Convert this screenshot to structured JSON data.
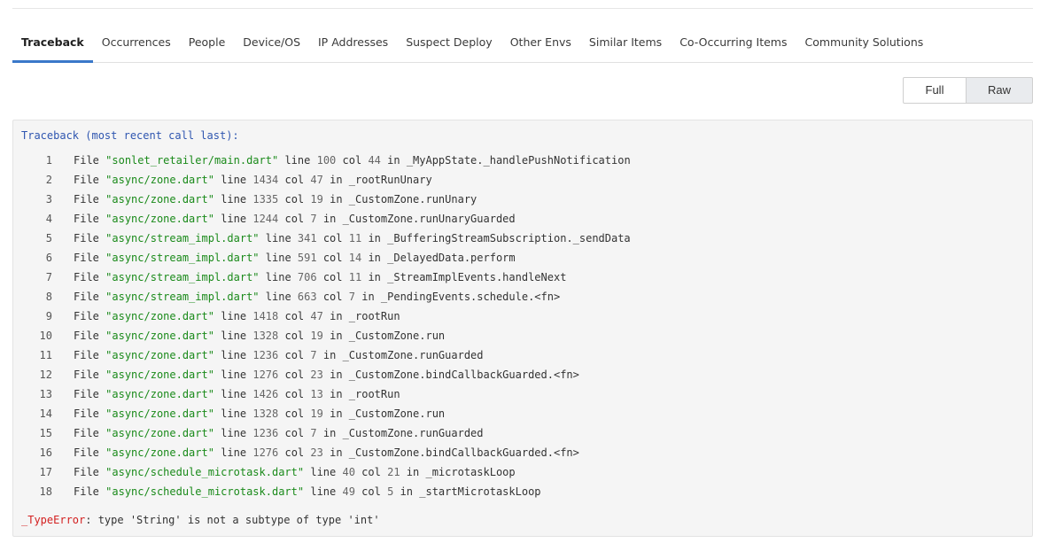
{
  "tabs": [
    {
      "label": "Traceback",
      "active": true
    },
    {
      "label": "Occurrences",
      "active": false
    },
    {
      "label": "People",
      "active": false
    },
    {
      "label": "Device/OS",
      "active": false
    },
    {
      "label": "IP Addresses",
      "active": false
    },
    {
      "label": "Suspect Deploy",
      "active": false
    },
    {
      "label": "Other Envs",
      "active": false
    },
    {
      "label": "Similar Items",
      "active": false
    },
    {
      "label": "Co-Occurring Items",
      "active": false
    },
    {
      "label": "Community Solutions",
      "active": false
    }
  ],
  "view_toggle": {
    "full_label": "Full",
    "raw_label": "Raw",
    "selected": "Raw"
  },
  "traceback": {
    "header": "Traceback (most recent call last):",
    "words": {
      "file": "File",
      "line": "line",
      "col": "col",
      "in": "in"
    },
    "frames": [
      {
        "n": "1",
        "file": "\"sonlet_retailer/main.dart\"",
        "line": "100",
        "col": "44",
        "func": "_MyAppState._handlePushNotification"
      },
      {
        "n": "2",
        "file": "\"async/zone.dart\"",
        "line": "1434",
        "col": "47",
        "func": "_rootRunUnary"
      },
      {
        "n": "3",
        "file": "\"async/zone.dart\"",
        "line": "1335",
        "col": "19",
        "func": "_CustomZone.runUnary"
      },
      {
        "n": "4",
        "file": "\"async/zone.dart\"",
        "line": "1244",
        "col": "7",
        "func": "_CustomZone.runUnaryGuarded"
      },
      {
        "n": "5",
        "file": "\"async/stream_impl.dart\"",
        "line": "341",
        "col": "11",
        "func": "_BufferingStreamSubscription._sendData"
      },
      {
        "n": "6",
        "file": "\"async/stream_impl.dart\"",
        "line": "591",
        "col": "14",
        "func": "_DelayedData.perform"
      },
      {
        "n": "7",
        "file": "\"async/stream_impl.dart\"",
        "line": "706",
        "col": "11",
        "func": "_StreamImplEvents.handleNext"
      },
      {
        "n": "8",
        "file": "\"async/stream_impl.dart\"",
        "line": "663",
        "col": "7",
        "func": "_PendingEvents.schedule.<fn>"
      },
      {
        "n": "9",
        "file": "\"async/zone.dart\"",
        "line": "1418",
        "col": "47",
        "func": "_rootRun"
      },
      {
        "n": "10",
        "file": "\"async/zone.dart\"",
        "line": "1328",
        "col": "19",
        "func": "_CustomZone.run"
      },
      {
        "n": "11",
        "file": "\"async/zone.dart\"",
        "line": "1236",
        "col": "7",
        "func": "_CustomZone.runGuarded"
      },
      {
        "n": "12",
        "file": "\"async/zone.dart\"",
        "line": "1276",
        "col": "23",
        "func": "_CustomZone.bindCallbackGuarded.<fn>"
      },
      {
        "n": "13",
        "file": "\"async/zone.dart\"",
        "line": "1426",
        "col": "13",
        "func": "_rootRun"
      },
      {
        "n": "14",
        "file": "\"async/zone.dart\"",
        "line": "1328",
        "col": "19",
        "func": "_CustomZone.run"
      },
      {
        "n": "15",
        "file": "\"async/zone.dart\"",
        "line": "1236",
        "col": "7",
        "func": "_CustomZone.runGuarded"
      },
      {
        "n": "16",
        "file": "\"async/zone.dart\"",
        "line": "1276",
        "col": "23",
        "func": "_CustomZone.bindCallbackGuarded.<fn>"
      },
      {
        "n": "17",
        "file": "\"async/schedule_microtask.dart\"",
        "line": "40",
        "col": "21",
        "func": "_microtaskLoop"
      },
      {
        "n": "18",
        "file": "\"async/schedule_microtask.dart\"",
        "line": "49",
        "col": "5",
        "func": "_startMicrotaskLoop"
      }
    ],
    "error_type": "_TypeError",
    "error_message": ": type 'String' is not a subtype of type 'int'"
  },
  "colors": {
    "active_tab_underline": "#3a78c9",
    "file_path": "#1a8a1a",
    "error_type": "#d32020",
    "header_text": "#2f56b0"
  }
}
